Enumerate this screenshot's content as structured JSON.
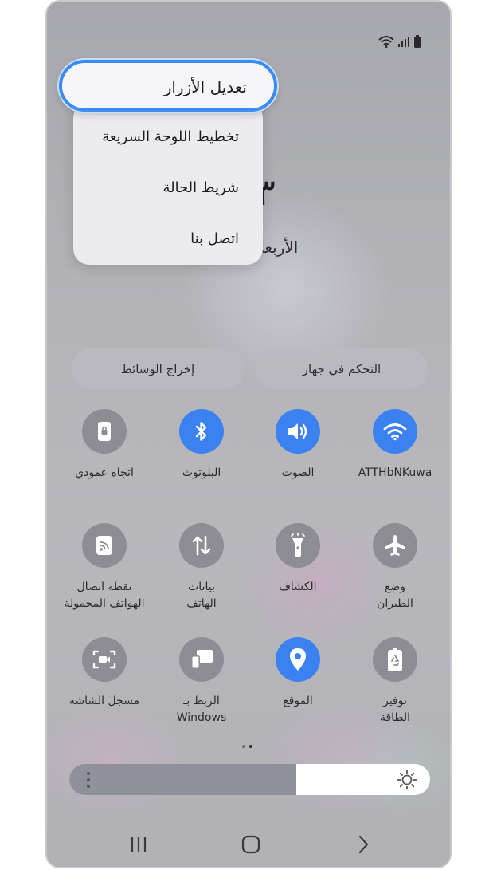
{
  "screenshot": {
    "status_bar": {
      "icons": [
        "wifi-icon",
        "signal-icon",
        "battery-icon"
      ]
    },
    "background": {
      "time_partial": "٣",
      "day_partial": "الأربعاء"
    },
    "context_menu": {
      "items": [
        {
          "label": "تعديل الأزرار",
          "highlighted": true
        },
        {
          "label": "تخطيط اللوحة السريعة"
        },
        {
          "label": "شريط الحالة"
        },
        {
          "label": "اتصل بنا"
        }
      ]
    },
    "quick_buttons": {
      "device_control": "التحكم في جهاز",
      "media_output": "إخراج الوسائط"
    },
    "tiles": [
      {
        "label": "ATTHbNKuwa",
        "icon": "wifi-icon",
        "active": true
      },
      {
        "label": "الصوت",
        "icon": "volume-icon",
        "active": true
      },
      {
        "label": "البلوتوث",
        "icon": "bluetooth-icon",
        "active": true
      },
      {
        "label": "اتجاه عمودي",
        "icon": "portrait-lock-icon",
        "active": false
      },
      {
        "label": "وضع\nالطيران",
        "icon": "airplane-icon",
        "active": false
      },
      {
        "label": "الكشاف",
        "icon": "flashlight-icon",
        "active": false
      },
      {
        "label": "بيانات\nالهاتف",
        "icon": "mobile-data-icon",
        "active": false
      },
      {
        "label": "نقطة اتصال\nالهواتف المحمولة",
        "icon": "hotspot-icon",
        "active": false
      },
      {
        "label": "توفير\nالطاقة",
        "icon": "power-saving-icon",
        "active": false
      },
      {
        "label": "الموقع",
        "icon": "location-icon",
        "active": true
      },
      {
        "label": "الربط بـ Windows",
        "icon": "link-to-windows-icon",
        "active": false
      },
      {
        "label": "مسجل الشاشة",
        "icon": "screen-recorder-icon",
        "active": false
      }
    ],
    "page_indicator": {
      "pages": 2,
      "current": 2
    },
    "brightness": {
      "level_percent": 63,
      "icon": "sun-icon"
    },
    "nav_bar": {
      "buttons": [
        "recent-apps-button",
        "home-button",
        "back-button"
      ]
    },
    "colors": {
      "accent": "#3b82f0",
      "focus_ring": "#3b8cf2",
      "tile_off": "#8d8d93"
    }
  }
}
